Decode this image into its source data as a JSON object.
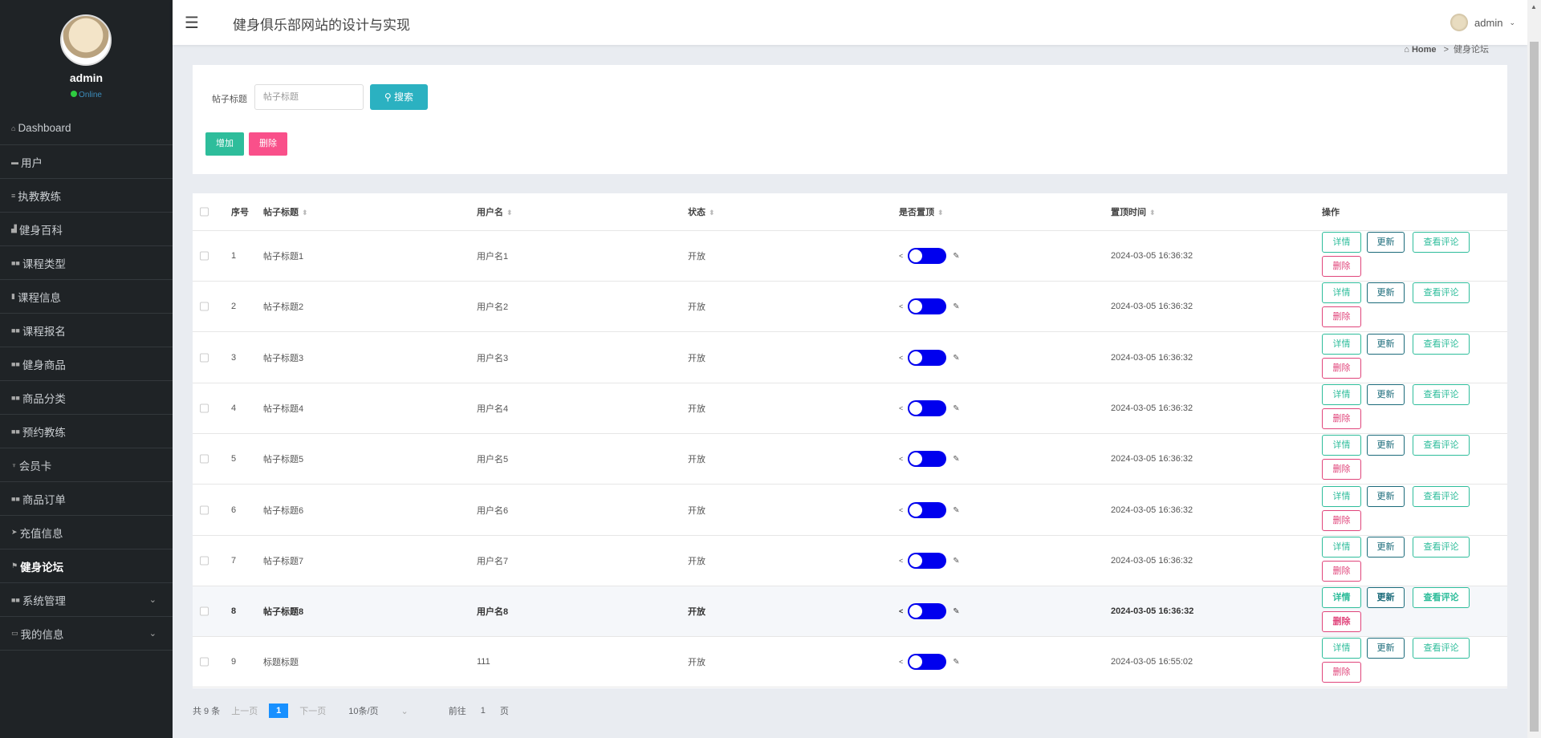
{
  "sidebar": {
    "user": "admin",
    "status": "Online",
    "items": [
      {
        "label": "Dashboard",
        "icon": "home-icon"
      },
      {
        "label": "用户",
        "icon": "monitor-icon"
      },
      {
        "label": "执教教练",
        "icon": "list-icon"
      },
      {
        "label": "健身百科",
        "icon": "chart-icon"
      },
      {
        "label": "课程类型",
        "icon": "grid-icon"
      },
      {
        "label": "课程信息",
        "icon": "bar-icon"
      },
      {
        "label": "课程报名",
        "icon": "grid-icon"
      },
      {
        "label": "健身商品",
        "icon": "grid-icon"
      },
      {
        "label": "商品分类",
        "icon": "grid-icon"
      },
      {
        "label": "预约教练",
        "icon": "grid-icon"
      },
      {
        "label": "会员卡",
        "icon": "trophy-icon"
      },
      {
        "label": "商品订单",
        "icon": "grid-icon"
      },
      {
        "label": "充值信息",
        "icon": "send-icon"
      },
      {
        "label": "健身论坛",
        "icon": "flag-icon"
      },
      {
        "label": "系统管理",
        "icon": "grid-icon"
      },
      {
        "label": "我的信息",
        "icon": "card-icon"
      }
    ]
  },
  "header": {
    "title": "健身俱乐部网站的设计与实现",
    "user": "admin"
  },
  "breadcrumb": {
    "home": "Home",
    "sep": ">",
    "current": "健身论坛"
  },
  "search": {
    "label": "帖子标题",
    "placeholder": "帖子标题",
    "button": "搜索"
  },
  "actions": {
    "add": "增加",
    "delete": "删除"
  },
  "table": {
    "headers": [
      "序号",
      "帖子标题",
      "用户名",
      "状态",
      "是否置顶",
      "置顶时间",
      "操作"
    ],
    "ops": {
      "detail": "详情",
      "update": "更新",
      "comments": "查看评论",
      "delete": "删除"
    },
    "rows": [
      [
        "1",
        "帖子标题1",
        "用户名1",
        "开放",
        "2024-03-05 16:36:32"
      ],
      [
        "2",
        "帖子标题2",
        "用户名2",
        "开放",
        "2024-03-05 16:36:32"
      ],
      [
        "3",
        "帖子标题3",
        "用户名3",
        "开放",
        "2024-03-05 16:36:32"
      ],
      [
        "4",
        "帖子标题4",
        "用户名4",
        "开放",
        "2024-03-05 16:36:32"
      ],
      [
        "5",
        "帖子标题5",
        "用户名5",
        "开放",
        "2024-03-05 16:36:32"
      ],
      [
        "6",
        "帖子标题6",
        "用户名6",
        "开放",
        "2024-03-05 16:36:32"
      ],
      [
        "7",
        "帖子标题7",
        "用户名7",
        "开放",
        "2024-03-05 16:36:32"
      ],
      [
        "8",
        "帖子标题8",
        "用户名8",
        "开放",
        "2024-03-05 16:36:32"
      ],
      [
        "9",
        "标题标题",
        "111",
        "开放",
        "2024-03-05 16:55:02"
      ]
    ]
  },
  "pagination": {
    "total": "共 9 条",
    "prev": "上一页",
    "page": "1",
    "next": "下一页",
    "size": "10条/页",
    "goto": "前往",
    "goto_page": "1",
    "page_unit": "页"
  }
}
